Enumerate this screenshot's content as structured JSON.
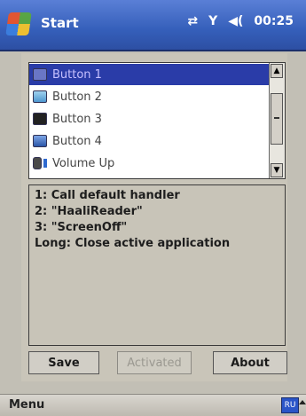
{
  "titlebar": {
    "title": "Start",
    "time": "00:25",
    "status": {
      "connectivity": "⇄",
      "signal": "Y",
      "volume": "◀("
    }
  },
  "buttons_list": {
    "items": [
      {
        "label": "Button 1",
        "icon": "button-1-icon",
        "selected": true
      },
      {
        "label": "Button 2",
        "icon": "button-2-icon",
        "selected": false
      },
      {
        "label": "Button 3",
        "icon": "button-3-icon",
        "selected": false
      },
      {
        "label": "Button 4",
        "icon": "button-4-icon",
        "selected": false
      },
      {
        "label": "Volume Up",
        "icon": "volume-up-icon",
        "selected": false
      }
    ],
    "scroll_up": "▲",
    "scroll_down": "▼"
  },
  "description": {
    "lines": [
      "1: Call default handler",
      "2: \"HaaliReader\"",
      "3: \"ScreenOff\"",
      "Long: Close active application"
    ]
  },
  "actions": {
    "save": "Save",
    "activated": "Activated",
    "about": "About"
  },
  "bottombar": {
    "menu": "Menu",
    "input_indicator": "RU"
  }
}
